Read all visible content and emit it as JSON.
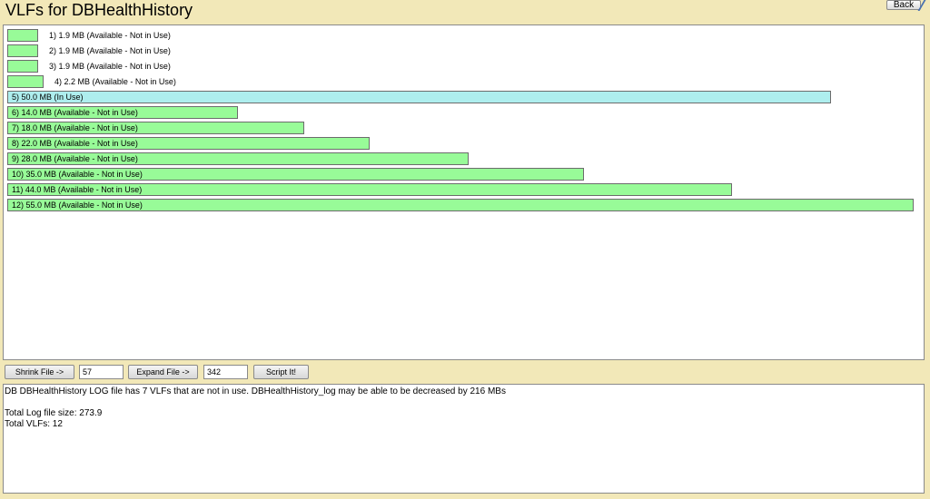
{
  "header": {
    "title": "VLFs for DBHealthHistory",
    "back_label": "Back"
  },
  "chart_data": {
    "type": "bar",
    "orientation": "horizontal",
    "unit": "MB",
    "categories": [
      "1",
      "2",
      "3",
      "4",
      "5",
      "6",
      "7",
      "8",
      "9",
      "10",
      "11",
      "12"
    ],
    "values": [
      1.9,
      1.9,
      1.9,
      2.2,
      50.0,
      14.0,
      18.0,
      22.0,
      28.0,
      35.0,
      44.0,
      55.0
    ],
    "labels": [
      "1) 1.9 MB (Available - Not in Use)",
      "2) 1.9 MB (Available - Not in Use)",
      "3) 1.9 MB (Available - Not in Use)",
      "4) 2.2 MB (Available - Not in Use)",
      "5) 50.0 MB (In Use)",
      "6) 14.0 MB (Available - Not in Use)",
      "7) 18.0 MB (Available - Not in Use)",
      "8) 22.0 MB (Available - Not in Use)",
      "9) 28.0 MB (Available - Not in Use)",
      "10) 35.0 MB (Available - Not in Use)",
      "11) 44.0 MB (Available - Not in Use)",
      "12) 55.0 MB (Available - Not in Use)"
    ],
    "status": [
      "available",
      "available",
      "available",
      "available",
      "in-use",
      "available",
      "available",
      "available",
      "available",
      "available",
      "available",
      "available"
    ],
    "colors": {
      "available": "#98fb98",
      "in-use": "#aeeeee"
    },
    "max": 55.0
  },
  "toolbar": {
    "shrink_label": "Shrink File ->",
    "shrink_value": "57",
    "expand_label": "Expand File ->",
    "expand_value": "342",
    "script_label": "Script It!"
  },
  "info": {
    "summary": "DB DBHealthHistory LOG file has 7 VLFs that are not in use. DBHealthHistory_log may be able to be decreased by 216 MBs",
    "total_size": "Total Log file size: 273.9",
    "total_vlfs": "Total VLFs: 12"
  }
}
